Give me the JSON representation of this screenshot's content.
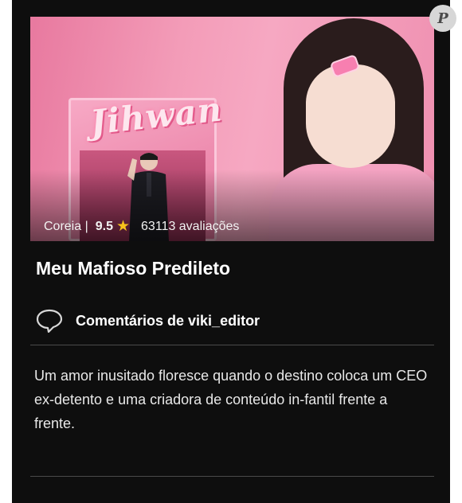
{
  "show": {
    "title": "Meu Mafioso Predileto",
    "poster_sign": "Jihwan",
    "poster_clip_text": "JIHWAN",
    "country_label": "Coreia |",
    "rating": "9.5",
    "star_glyph": "★",
    "reviews_label": "63113 avaliações"
  },
  "comments": {
    "icon": "speech-bubble-icon",
    "label": "Comentários de viki_editor",
    "text": "Um amor inusitado floresce quando o destino coloca um CEO ex-detento e uma criadora de conteúdo in-fantil frente a frente."
  },
  "corner_badge": {
    "icon": "pinterest-icon",
    "glyph": "P"
  },
  "colors": {
    "card_background": "#0e0e0e",
    "page_background": "#ffffff",
    "star": "#f7c31c",
    "divider": "#4a4a4a"
  }
}
